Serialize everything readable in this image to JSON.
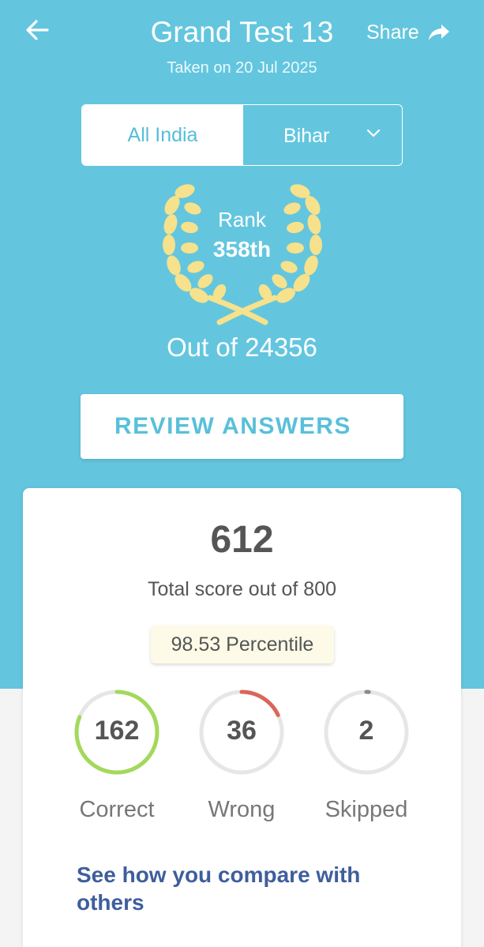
{
  "header": {
    "title": "Grand Test 13",
    "subtitle": "Taken on 20 Jul 2025",
    "share_label": "Share",
    "back_icon": "arrow-left-icon",
    "share_icon": "share-arrow-icon"
  },
  "segment": {
    "all_india_label": "All India",
    "state_label": "Bihar",
    "selected": "All India"
  },
  "rank": {
    "label": "Rank",
    "value": "358th",
    "out_of": "Out of 24356",
    "icon": "laurel-wreath-icon"
  },
  "review_button_label": "REVIEW ANSWERS",
  "score_card": {
    "score": "612",
    "caption": "Total score out of 800",
    "percentile": "98.53 Percentile"
  },
  "stats": [
    {
      "count": "162",
      "label": "Correct",
      "fraction": 0.81,
      "color": "#a3d95a"
    },
    {
      "count": "36",
      "label": "Wrong",
      "fraction": 0.18,
      "color": "#d9675b"
    },
    {
      "count": "2",
      "label": "Skipped",
      "fraction": 0.01,
      "color": "#8a8a8a"
    }
  ],
  "compare_link": "See how you compare with others",
  "colors": {
    "hero_bg": "#63c6de",
    "laurel": "#f6e18c",
    "link": "#3e5e9c"
  }
}
